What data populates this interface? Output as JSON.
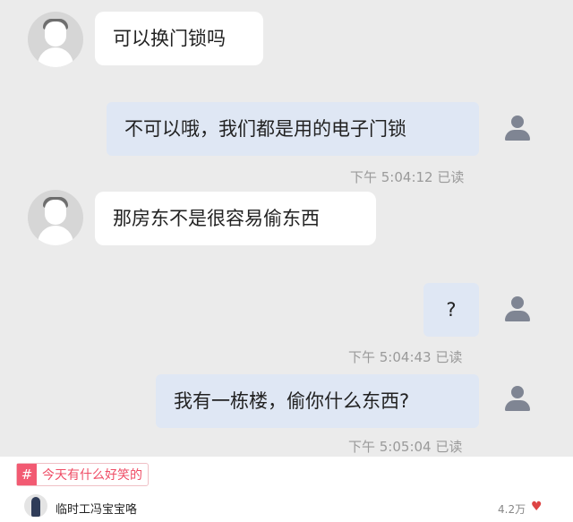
{
  "messages": [
    {
      "side": "left",
      "text": "可以换门锁吗"
    },
    {
      "side": "right",
      "text": "不可以哦，我们都是用的电子门锁",
      "time": "下午 5:04:12 已读"
    },
    {
      "side": "left",
      "text": "那房东不是很容易偷东西"
    },
    {
      "side": "right",
      "text": "?",
      "time": "下午 5:04:43 已读"
    },
    {
      "side": "right",
      "text": "我有一栋楼，偷你什么东西?",
      "time": "下午 5:05:04 已读"
    }
  ],
  "topic_tag": {
    "hash": "#",
    "label": "今天有什么好笑的"
  },
  "post": {
    "username": "临时工冯宝宝咯",
    "like_count": "4.2万",
    "like_icon": "heart-icon"
  }
}
